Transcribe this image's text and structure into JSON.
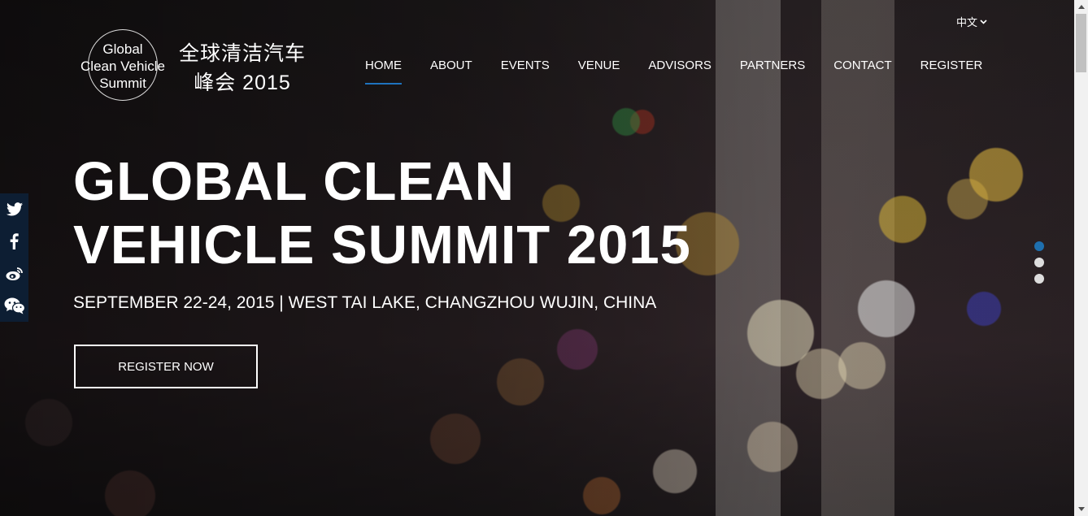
{
  "logo": {
    "en_lines": [
      "Global",
      "Clean Vehicle",
      "Summit"
    ],
    "cn_line1": "全球清洁汽车",
    "cn_line2": "峰会 2015"
  },
  "language": {
    "label": "中文",
    "icon": "chevron-down-icon"
  },
  "nav": {
    "items": [
      {
        "label": "HOME",
        "active": true
      },
      {
        "label": "ABOUT"
      },
      {
        "label": "EVENTS"
      },
      {
        "label": "VENUE"
      },
      {
        "label": "ADVISORS"
      },
      {
        "label": "PARTNERS"
      },
      {
        "label": "CONTACT"
      },
      {
        "label": "REGISTER"
      }
    ],
    "active_color": "#1e73be"
  },
  "hero": {
    "title_line1": "GLOBAL CLEAN",
    "title_line2": "VEHICLE SUMMIT 2015",
    "subtitle": "SEPTEMBER 22-24, 2015 | WEST TAI LAKE, CHANGZHOU WUJIN, CHINA",
    "cta_label": "REGISTER NOW"
  },
  "social": {
    "background": "#0d1e33",
    "icons": [
      "twitter-icon",
      "facebook-icon",
      "weibo-icon",
      "wechat-icon"
    ]
  },
  "slider": {
    "slides": 3,
    "active_index": 0,
    "active_color": "#1e6fae"
  }
}
